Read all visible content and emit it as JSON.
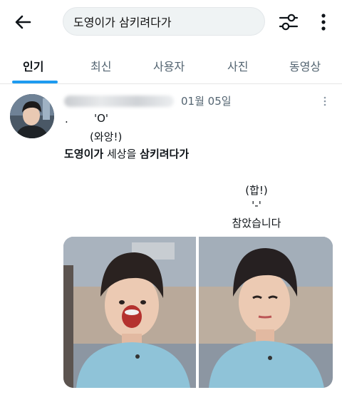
{
  "search": {
    "query": "도영이가 삼키려다가"
  },
  "tabs": [
    "인기",
    "최신",
    "사용자",
    "사진",
    "동영상"
  ],
  "tweet": {
    "date": "01월 05일",
    "line1": "'O'",
    "line2": "(와앙!)",
    "main_bold1": "도영이가",
    "main_normal": " 세상을 ",
    "main_bold2": "삼키려다가",
    "center1": "(합!)",
    "center2": "'-'",
    "center3": "참았습니다"
  },
  "colors": {
    "accent": "#1d9bf0",
    "text": "#0f1419",
    "muted": "#536471"
  },
  "icons": {
    "back": "back-arrow-icon",
    "filter": "filter-icon",
    "more": "more-vertical-icon"
  }
}
